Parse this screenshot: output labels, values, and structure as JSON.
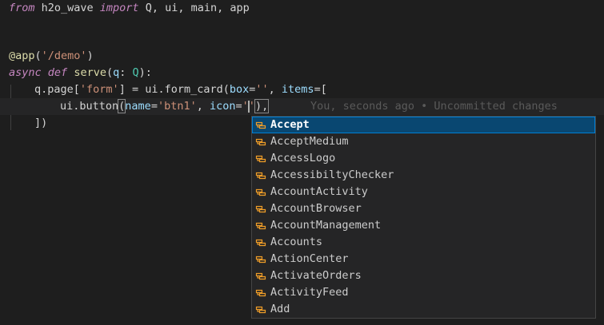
{
  "code": {
    "line1": {
      "from": "from",
      "module": " h2o_wave ",
      "import": "import",
      "names": " Q, ui, main, app"
    },
    "line4": {
      "decorator": "@app",
      "open": "(",
      "route": "'/demo'",
      "close": ")"
    },
    "line5": {
      "async": "async",
      "def": "def",
      "func": "serve",
      "open": "(",
      "param": "q",
      "colon": ": ",
      "type": "Q",
      "close": "):"
    },
    "line6": {
      "prefix": "q.page[",
      "key": "'form'",
      "mid": "] = ui.form_card(",
      "box_kw": "box",
      "eq1": "=",
      "box_val": "''",
      "comma": ", ",
      "items_kw": "items",
      "tail": "=["
    },
    "line7": {
      "prefix": "ui.button",
      "open": "(",
      "name_kw": "name",
      "eq1": "=",
      "name_val": "'btn1'",
      "comma": ", ",
      "icon_kw": "icon",
      "eq2": "=",
      "quote1": "'",
      "quote2": "'",
      "tail": "),"
    },
    "line8": {
      "text": "])"
    },
    "blame": "You, seconds ago • Uncommitted changes"
  },
  "suggestions": [
    {
      "label": "Accept",
      "selected": true
    },
    {
      "label": "AcceptMedium"
    },
    {
      "label": "AccessLogo"
    },
    {
      "label": "AccessibiltyChecker"
    },
    {
      "label": "AccountActivity"
    },
    {
      "label": "AccountBrowser"
    },
    {
      "label": "AccountManagement"
    },
    {
      "label": "Accounts"
    },
    {
      "label": "ActionCenter"
    },
    {
      "label": "ActivateOrders"
    },
    {
      "label": "ActivityFeed"
    },
    {
      "label": "Add"
    }
  ],
  "colors": {
    "selected_bg": "#094771",
    "icon_color": "#ee9d28"
  },
  "icon_name": "snippet-icon"
}
